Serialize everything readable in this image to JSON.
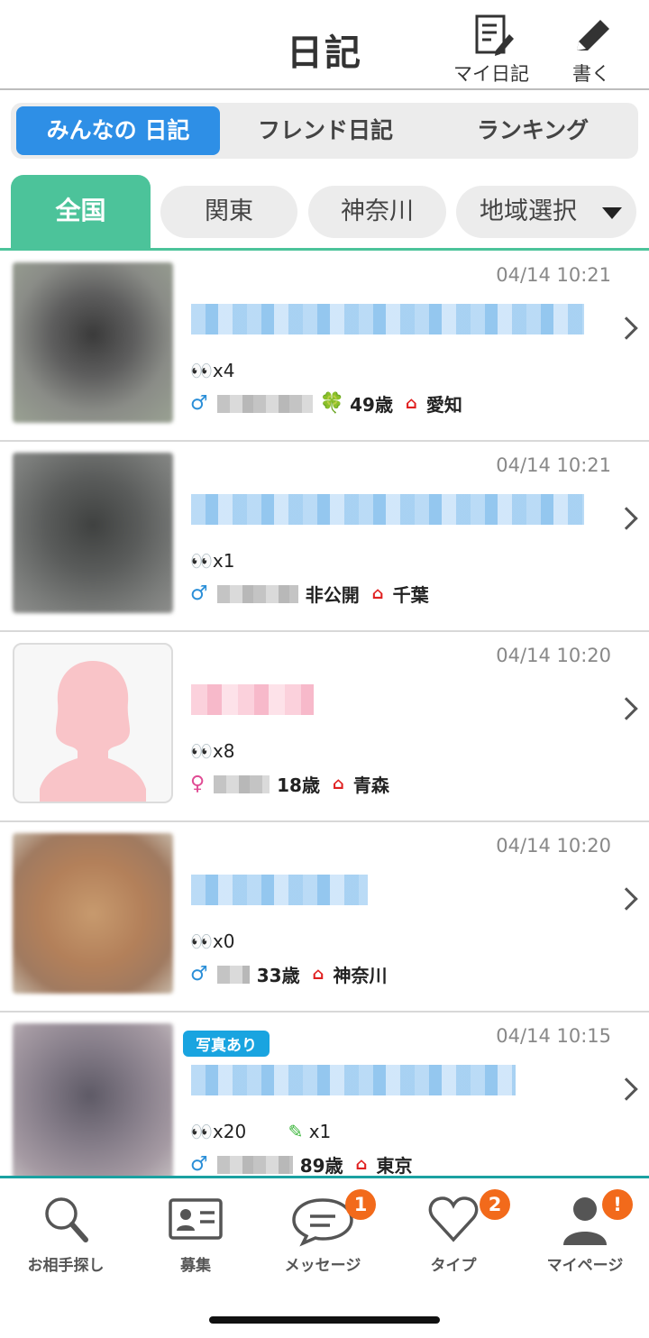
{
  "header": {
    "title": "日記",
    "my_diary_label": "マイ日記",
    "write_label": "書く"
  },
  "tabs": [
    {
      "label": "みんなの 日記",
      "active": true
    },
    {
      "label": "フレンド日記",
      "active": false
    },
    {
      "label": "ランキング",
      "active": false
    }
  ],
  "regions": [
    {
      "label": "全国",
      "active": true
    },
    {
      "label": "関東",
      "active": false
    },
    {
      "label": "神奈川",
      "active": false
    },
    {
      "label": "地域選択",
      "active": false
    }
  ],
  "entries": [
    {
      "date": "04/14 10:21",
      "views": "x4",
      "gender": "♂",
      "age": "49歳",
      "location": "愛知",
      "clover": true,
      "title_color": "blue"
    },
    {
      "date": "04/14 10:21",
      "views": "x1",
      "gender": "♂",
      "age": "非公開",
      "location": "千葉",
      "clover": false,
      "title_color": "blue"
    },
    {
      "date": "04/14 10:20",
      "views": "x8",
      "gender": "♀",
      "age": "18歳",
      "location": "青森",
      "clover": false,
      "title_color": "pink"
    },
    {
      "date": "04/14 10:20",
      "views": "x0",
      "gender": "♂",
      "age": "33歳",
      "location": "神奈川",
      "clover": false,
      "title_color": "blue"
    },
    {
      "date": "04/14 10:15",
      "views": "x20",
      "edits": "x1",
      "badge": "写真あり",
      "gender": "♂",
      "age": "89歳",
      "location": "東京",
      "clover": false,
      "title_color": "blue"
    }
  ],
  "bottom_nav": [
    {
      "label": "お相手探し",
      "icon": "search-icon"
    },
    {
      "label": "募集",
      "icon": "id-card-icon"
    },
    {
      "label": "メッセージ",
      "icon": "chat-icon",
      "badge": "1"
    },
    {
      "label": "タイプ",
      "icon": "heart-icon",
      "badge": "2"
    },
    {
      "label": "マイページ",
      "icon": "user-icon",
      "badge": "!"
    }
  ],
  "colors": {
    "accent_green": "#4cc39a",
    "tab_blue": "#2e8fe6",
    "badge_orange": "#f26a1b",
    "nav_border": "#1aa1a1"
  }
}
